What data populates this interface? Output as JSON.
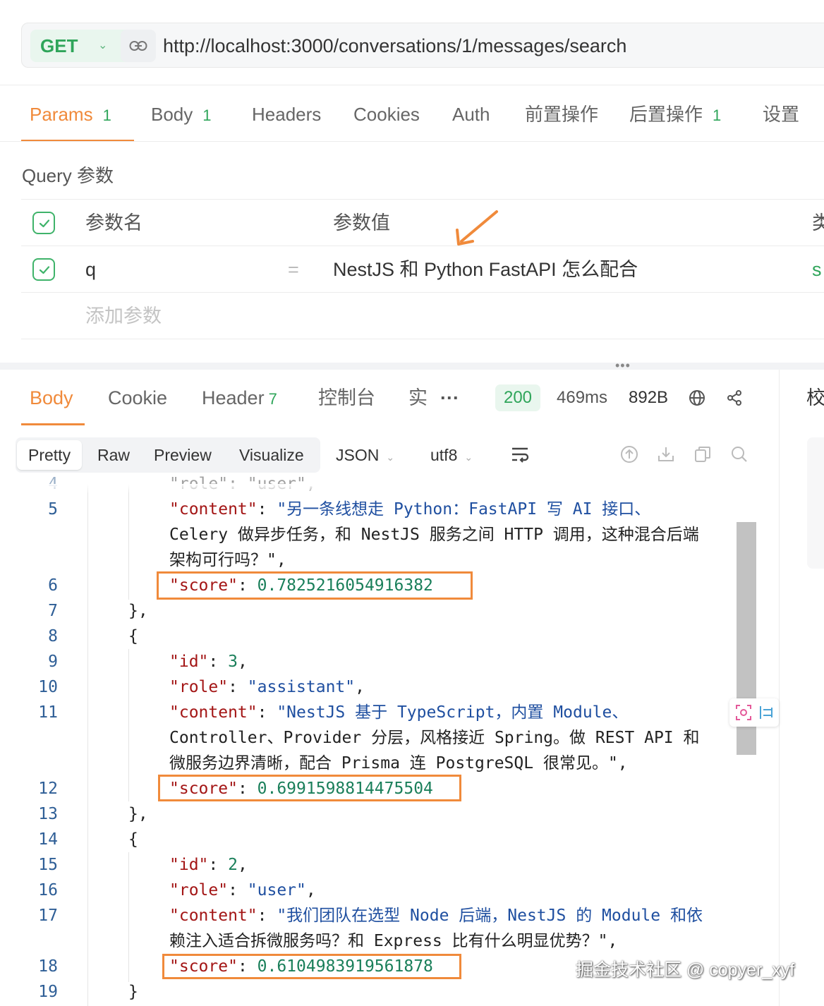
{
  "request": {
    "method": "GET",
    "url": "http://localhost:3000/conversations/1/messages/search"
  },
  "request_tabs": [
    {
      "label": "Params",
      "count": "1"
    },
    {
      "label": "Body",
      "count": "1"
    },
    {
      "label": "Headers"
    },
    {
      "label": "Cookies"
    },
    {
      "label": "Auth"
    },
    {
      "label": "前置操作"
    },
    {
      "label": "后置操作",
      "count": "1"
    },
    {
      "label": "设置"
    }
  ],
  "query": {
    "section_title": "Query 参数",
    "header_name": "参数名",
    "header_value": "参数值",
    "header_type_partial": "类",
    "row": {
      "name": "q",
      "equals": "=",
      "value": "NestJS 和 Python FastAPI 怎么配合",
      "type_partial": "s"
    },
    "add_placeholder": "添加参数"
  },
  "response": {
    "tabs": [
      {
        "label": "Body"
      },
      {
        "label": "Cookie"
      },
      {
        "label": "Header",
        "count": "7"
      },
      {
        "label": "控制台"
      },
      {
        "label": "实"
      }
    ],
    "more": "···",
    "status": "200",
    "time": "469ms",
    "size": "892B",
    "side_label": "校"
  },
  "format_toolbar": {
    "modes": [
      "Pretty",
      "Raw",
      "Preview",
      "Visualize"
    ],
    "language": "JSON",
    "encoding": "utf8"
  },
  "code": {
    "line_numbers": [
      "4",
      "5",
      "6",
      "7",
      "8",
      "9",
      "10",
      "11",
      "12",
      "13",
      "14",
      "15",
      "16",
      "17",
      "18",
      "19"
    ],
    "partial_top": "\"role\": \"user\",",
    "entries": [
      {
        "content_lines": [
          "\"另一条线想走 Python：FastAPI 写 AI 接口、",
          "Celery 做异步任务，和 NestJS 服务之间 HTTP 调用，这种混合后端",
          "架构可行吗？\","
        ],
        "score": "0.7825216054916382"
      },
      {
        "id": "3",
        "role": "\"assistant\"",
        "content_lines": [
          "\"NestJS 基于 TypeScript，内置 Module、",
          "Controller、Provider 分层，风格接近 Spring。做 REST API 和",
          "微服务边界清晰，配合 Prisma 连 PostgreSQL 很常见。\","
        ],
        "score": "0.6991598814475504"
      },
      {
        "id": "2",
        "role": "\"user\"",
        "content_lines": [
          "\"我们团队在选型 Node 后端，NestJS 的 Module 和依",
          "赖注入适合拆微服务吗？和 Express 比有什么明显优势？\","
        ],
        "score": "0.6104983919561878"
      }
    ],
    "close_brace": "},",
    "open_brace": "{",
    "partial_bottom": "}"
  },
  "watermark": "掘金技术社区 @ copyer_xyf",
  "colors": {
    "accent": "#f08a3b",
    "success": "#2fa55a",
    "json_key": "#a31515",
    "json_string": "#1f4fa0",
    "json_number": "#1a7f5a"
  }
}
